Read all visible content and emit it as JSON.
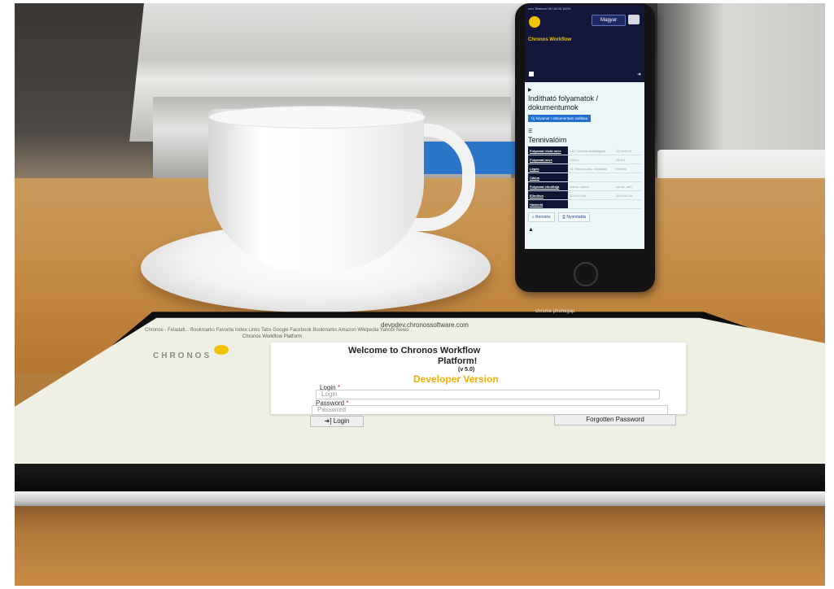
{
  "phone": {
    "status": "••••• Telekom HU  16:03   100%",
    "lang_button": "Magyar",
    "brand": "Chronos Workflow",
    "section1_title": "Indítható folyamatok / dokumentumok",
    "start_button": "Új folyamat / dokumentum indítása",
    "section2_title": "Tennivalóim",
    "table": [
      {
        "key": "Folyamat rövid neve",
        "v1": "LAC Számla szállítagyás",
        "v2": "Új verzió je"
      },
      {
        "key": "Folyamat neve",
        "v1": "16014",
        "v2": "16014"
      },
      {
        "key": "Lépés",
        "v1": "01. Elszámolás, szignálás",
        "v2": "Kitöltés"
      },
      {
        "key": "Ciklus",
        "v1": "",
        "v2": ""
      },
      {
        "key": "Folyamat elindítója",
        "v1": "admin, admin",
        "v2": "admin, adn"
      },
      {
        "key": "Elindítva",
        "v1": "2014.03.06.",
        "v2": "2014.04.28."
      },
      {
        "key": "Határidő",
        "v1": "",
        "v2": ""
      }
    ],
    "search_button": "Keresés",
    "print_button": "Nyomtatás"
  },
  "tablet": {
    "url": "devpdev.chronossoftware.com",
    "tab_title": "Chronos Workflow Platform",
    "bookmarks": "Chronos - Feladatl...   Bookmarks   Favorite   Index   Links   Tabs   Google   Facebook   Bookmarks   Amazon   Wikipedia   Yahoo!   News",
    "login_title_1": "Welcome to Chronos Workflow",
    "login_title_2": "Platform!",
    "version": "(v 5.0)",
    "edition": "Developer Version",
    "login_label": "Login",
    "login_placeholder": "Login",
    "password_label": "Password",
    "password_placeholder": "Password",
    "required_mark": "*",
    "login_button": "➜] Login",
    "forgot_button": "Forgotten Password",
    "logo_text": "CHRONOS"
  },
  "reflection": {
    "chrome": "chrome   phonegap"
  },
  "colors": {
    "brand_yellow": "#f0c400",
    "phone_header": "#14163a",
    "phone_button": "#1f6fd1",
    "required": "#d32f2f"
  }
}
